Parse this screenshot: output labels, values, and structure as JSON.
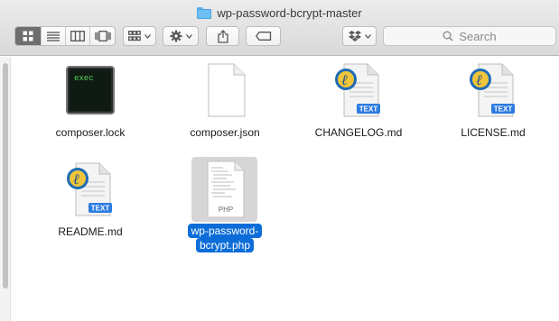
{
  "window": {
    "title": "wp-password-bcrypt-master",
    "folder_icon": "folder-icon"
  },
  "toolbar": {
    "view_buttons": [
      "icon-view-icon",
      "list-view-icon",
      "column-view-icon",
      "coverflow-view-icon"
    ],
    "arrange_icon": "arrange-grid-icon",
    "action_icon": "gear-icon",
    "share_icon": "share-icon",
    "tags_icon": "tag-icon",
    "dropbox_icon": "dropbox-icon",
    "search": {
      "placeholder": "Search",
      "icon": "search-icon"
    }
  },
  "files": [
    {
      "name": "composer.lock",
      "kind": "exec",
      "icon_text": "exec"
    },
    {
      "name": "composer.json",
      "kind": "blank"
    },
    {
      "name": "CHANGELOG.md",
      "kind": "text",
      "badge": "TEXT"
    },
    {
      "name": "LICENSE.md",
      "kind": "text",
      "badge": "TEXT"
    },
    {
      "name": "README.md",
      "kind": "text",
      "badge": "TEXT"
    },
    {
      "name_line1": "wp-password-",
      "name_line2": "bcrypt.php",
      "kind": "php",
      "badge": "PHP",
      "selected": true
    }
  ],
  "colors": {
    "selection": "#0d6dd8",
    "folder": "#6cc0f6"
  }
}
